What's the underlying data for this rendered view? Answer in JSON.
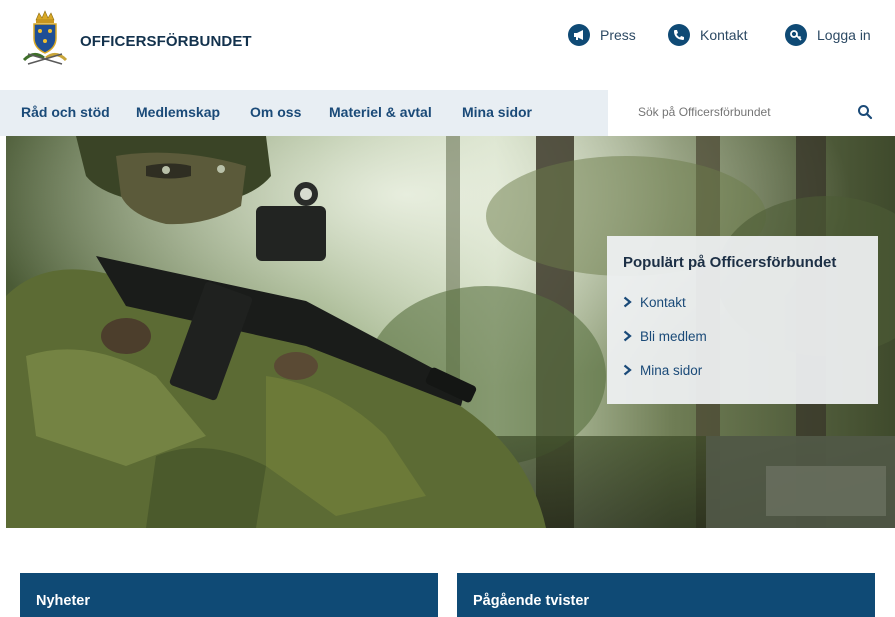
{
  "header": {
    "brand": "OFFICERSFÖRBUNDET",
    "utility_links": {
      "press": "Press",
      "contact": "Kontakt",
      "login": "Logga in"
    }
  },
  "nav": {
    "items": [
      "Råd och stöd",
      "Medlemskap",
      "Om oss",
      "Materiel & avtal",
      "Mina sidor"
    ],
    "search_placeholder": "Sök på Officersförbundet"
  },
  "popular": {
    "title": "Populärt på Officersförbundet",
    "links": [
      "Kontakt",
      "Bli medlem",
      "Mina sidor"
    ]
  },
  "cards": {
    "news": "Nyheter",
    "disputes": "Pågående tvister"
  },
  "colors": {
    "brand_blue": "#0f4a75",
    "nav_bg": "#e8eef3",
    "link_blue": "#1a4a78"
  }
}
